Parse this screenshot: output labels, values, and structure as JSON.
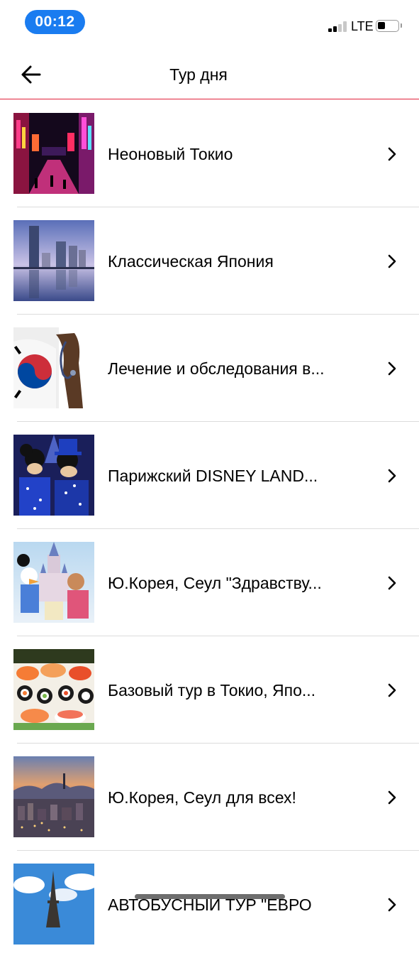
{
  "status_bar": {
    "time": "00:12",
    "network": "LTE",
    "signal_bars_active": 2,
    "signal_bars_total": 4
  },
  "header": {
    "title": "Тур дня",
    "back_icon": "arrow-left-icon"
  },
  "tours": [
    {
      "title": "Неоновый Токио",
      "thumb": "neon-tokyo-street"
    },
    {
      "title": "Классическая Япония",
      "thumb": "yokohama-skyline"
    },
    {
      "title": "Лечение и обследования в...",
      "thumb": "korea-flag-doctor"
    },
    {
      "title": "Парижский  DISNEY LAND...",
      "thumb": "mickey-minnie-costumes"
    },
    {
      "title": "Ю.Корея, Сеул \"Здравству...",
      "thumb": "disney-castle-characters"
    },
    {
      "title": "Базовый  тур в Токио, Япо...",
      "thumb": "sushi-platter"
    },
    {
      "title": "Ю.Корея, Сеул для всех!",
      "thumb": "seoul-city-sunset"
    },
    {
      "title": "АВТОБУСНЫЙ ТУР \"ЕВРО",
      "thumb": "eiffel-tower-sky"
    }
  ],
  "colors": {
    "accent": "#e0223a",
    "time_pill": "#1a7cf0"
  }
}
